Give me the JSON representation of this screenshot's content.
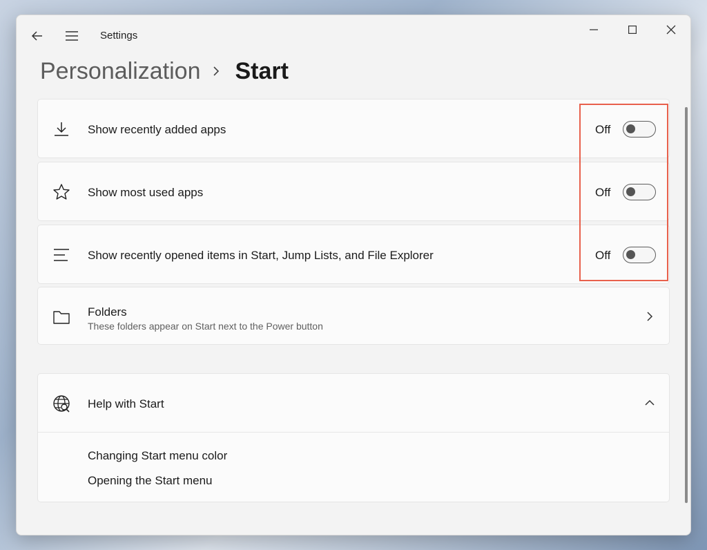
{
  "window": {
    "app_title": "Settings",
    "controls": {
      "minimize": "minimize-icon",
      "maximize": "maximize-icon",
      "close": "close-icon"
    }
  },
  "breadcrumb": {
    "parent": "Personalization",
    "current": "Start"
  },
  "settings": [
    {
      "icon": "download-icon",
      "label": "Show recently added apps",
      "state": "Off"
    },
    {
      "icon": "star-icon",
      "label": "Show most used apps",
      "state": "Off"
    },
    {
      "icon": "list-icon",
      "label": "Show recently opened items in Start, Jump Lists, and File Explorer",
      "state": "Off"
    }
  ],
  "folders": {
    "icon": "folder-icon",
    "label": "Folders",
    "description": "These folders appear on Start next to the Power button"
  },
  "help": {
    "icon": "globe-search-icon",
    "title": "Help with Start",
    "links": [
      "Changing Start menu color",
      "Opening the Start menu"
    ]
  },
  "colors": {
    "highlight": "#e8604c",
    "toggle_off": "#5d5d5d"
  }
}
